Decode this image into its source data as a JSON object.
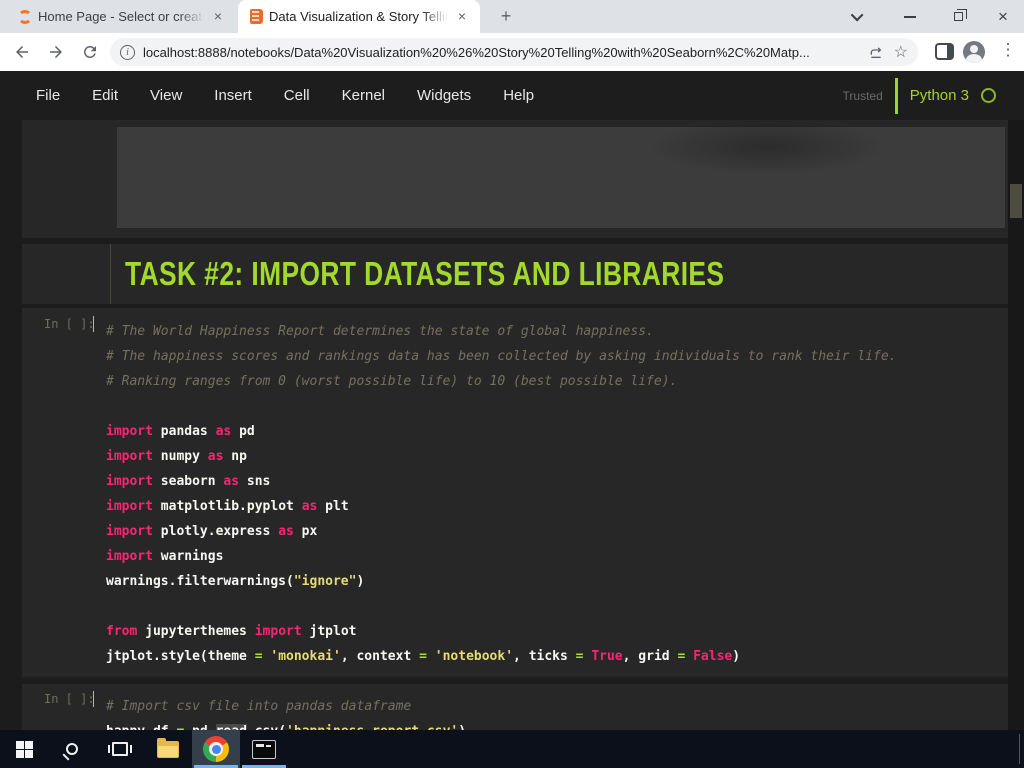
{
  "browser": {
    "tabs": [
      {
        "title": "Home Page - Select or create a n",
        "active": false
      },
      {
        "title": "Data Visualization & Story Telling",
        "active": true
      }
    ],
    "url": "localhost:8888/notebooks/Data%20Visualization%20%26%20Story%20Telling%20with%20Seaborn%2C%20Matp...",
    "icons": {
      "close_tab": "×",
      "new_tab": "+",
      "star": "☆",
      "kebab": "⋮",
      "info": "i"
    }
  },
  "jupyter": {
    "menu": [
      "File",
      "Edit",
      "View",
      "Insert",
      "Cell",
      "Kernel",
      "Widgets",
      "Help"
    ],
    "trusted": "Trusted",
    "kernel": "Python 3"
  },
  "notebook": {
    "heading": "TASK #2: IMPORT DATASETS AND LIBRARIES",
    "cell_imports": {
      "prompt": "In [ ]:",
      "lines": [
        [
          [
            "c",
            "# The World Happiness Report determines the state of global happiness."
          ]
        ],
        [
          [
            "c",
            "# The happiness scores and rankings data has been collected by asking individuals to rank their life."
          ]
        ],
        [
          [
            "c",
            "# Ranking ranges from 0 (worst possible life) to 10 (best possible life)."
          ]
        ],
        [],
        [
          [
            "k",
            "import"
          ],
          [
            "p",
            " pandas "
          ],
          [
            "k",
            "as"
          ],
          [
            "p",
            " pd"
          ]
        ],
        [
          [
            "k",
            "import"
          ],
          [
            "p",
            " numpy "
          ],
          [
            "k",
            "as"
          ],
          [
            "p",
            " np"
          ]
        ],
        [
          [
            "k",
            "import"
          ],
          [
            "p",
            " seaborn "
          ],
          [
            "k",
            "as"
          ],
          [
            "p",
            " sns"
          ]
        ],
        [
          [
            "k",
            "import"
          ],
          [
            "p",
            " matplotlib.pyplot "
          ],
          [
            "k",
            "as"
          ],
          [
            "p",
            " plt"
          ]
        ],
        [
          [
            "k",
            "import"
          ],
          [
            "p",
            " plotly.express "
          ],
          [
            "k",
            "as"
          ],
          [
            "p",
            " px"
          ]
        ],
        [
          [
            "k",
            "import"
          ],
          [
            "p",
            " warnings"
          ]
        ],
        [
          [
            "p",
            "warnings.filterwarnings("
          ],
          [
            "s",
            "\"ignore\""
          ],
          [
            "p",
            ")"
          ]
        ],
        [],
        [
          [
            "k",
            "from"
          ],
          [
            "p",
            " jupyterthemes "
          ],
          [
            "k",
            "import"
          ],
          [
            "p",
            " jtplot"
          ]
        ],
        [
          [
            "p",
            "jtplot.style(theme "
          ],
          [
            "o",
            "="
          ],
          [
            "p",
            " "
          ],
          [
            "s",
            "'monokai'"
          ],
          [
            "p",
            ", context "
          ],
          [
            "o",
            "="
          ],
          [
            "p",
            " "
          ],
          [
            "s",
            "'notebook'"
          ],
          [
            "p",
            ", ticks "
          ],
          [
            "o",
            "="
          ],
          [
            "p",
            " "
          ],
          [
            "k",
            "True"
          ],
          [
            "p",
            ", grid "
          ],
          [
            "o",
            "="
          ],
          [
            "p",
            " "
          ],
          [
            "k",
            "False"
          ],
          [
            "p",
            ")"
          ]
        ]
      ]
    },
    "cell_csv": {
      "prompt": "In [ ]:",
      "lines": [
        [
          [
            "c",
            "# Import csv file into pandas dataframe"
          ]
        ],
        [
          [
            "p",
            "happy_df "
          ],
          [
            "o",
            "="
          ],
          [
            "p",
            " pd."
          ],
          [
            "hl",
            "read"
          ],
          [
            "p",
            "_csv("
          ],
          [
            "s",
            "'happiness_report.csv'"
          ],
          [
            "p",
            ")"
          ]
        ]
      ]
    }
  },
  "colors": {
    "heading_green": "#a2d92d",
    "keyword_pink": "#f92672",
    "string_yellow": "#e6db74",
    "operator_green": "#a6e22e",
    "comment_gray": "#75715e",
    "kernel_green": "#9ed32c",
    "taskbar_accent": "#71b7e8"
  }
}
